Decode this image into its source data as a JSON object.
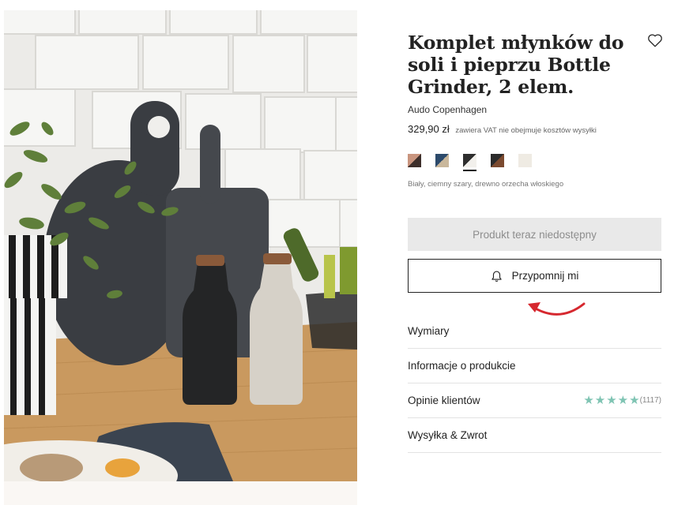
{
  "product": {
    "title": "Komplet młynków do soli i pieprzu Bottle Grinder, 2 elem.",
    "brand": "Audo Copenhagen",
    "price": "329,90 zł",
    "vat_note": "zawiera VAT nie obejmuje kosztów wysyłki",
    "color_name": "Biały, ciemny szary, drewno orzecha włoskiego",
    "swatches": [
      {
        "name": "swatch-rose-dark",
        "color_a": "#c9957f",
        "color_b": "#3d2f2b"
      },
      {
        "name": "swatch-blue-beige",
        "color_a": "#2c4a6b",
        "color_b": "#c9b79b"
      },
      {
        "name": "swatch-dark-white",
        "color_a": "#2e2e2e",
        "color_b": "#f2f0ec",
        "selected": true
      },
      {
        "name": "swatch-dark-walnut",
        "color_a": "#2b2b2b",
        "color_b": "#7b4a2f"
      },
      {
        "name": "swatch-cream",
        "color_a": "#efebe3",
        "color_b": "#efebe3"
      }
    ]
  },
  "buttons": {
    "unavailable_label": "Produkt teraz niedostępny",
    "remind_label": "Przypomnij mi"
  },
  "accordion": {
    "dimensions": "Wymiary",
    "product_info": "Informacje o produkcie",
    "reviews": "Opinie klientów",
    "reviews_count": "(1117)",
    "reviews_stars": 5,
    "shipping": "Wysyłka & Zwrot"
  },
  "colors": {
    "star": "#7fc4b3",
    "arrow": "#d6282f",
    "button_disabled_bg": "#e9e9e9"
  },
  "icons": [
    "heart-icon",
    "bell-icon",
    "star-icon",
    "arrow-annotation"
  ]
}
